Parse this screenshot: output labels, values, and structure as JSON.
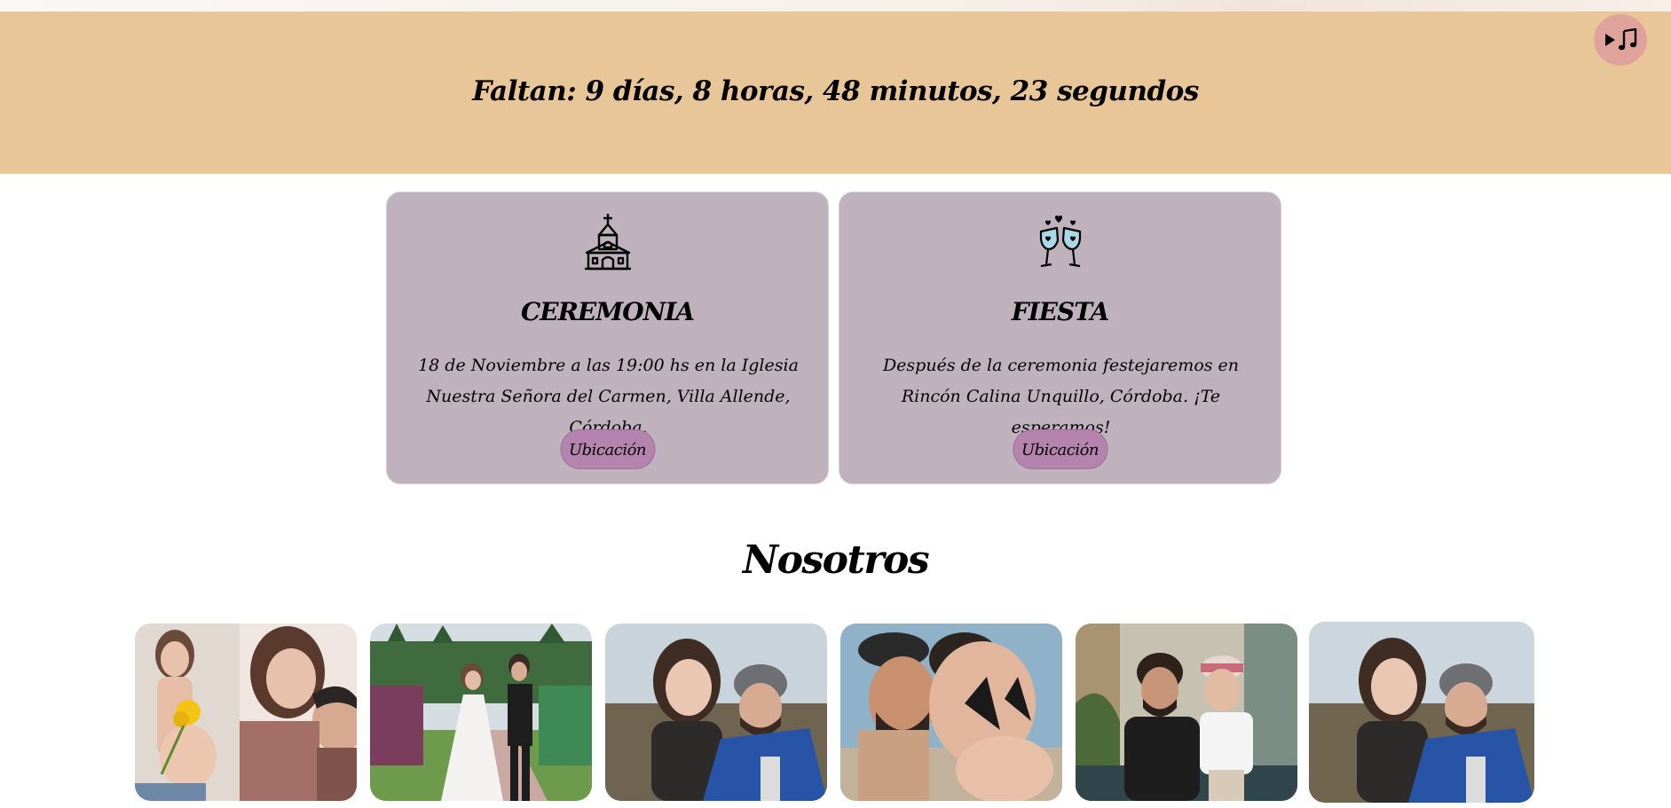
{
  "countdown": {
    "text": "Faltan: 9 días, 8 horas, 48 minutos, 23 segundos"
  },
  "music_button": {
    "icon": "play-music-icon"
  },
  "events": [
    {
      "icon": "church-icon",
      "title": "CEREMONIA",
      "text": "18 de Noviembre a las 19:00 hs en la Iglesia Nuestra Señora del Carmen, Villa Allende, Córdoba.",
      "button": "Ubicación"
    },
    {
      "icon": "toast-glasses-icon",
      "title": "FIESTA",
      "text": "Después de la ceremonia festejaremos en Rincón Calina Unquillo, Córdoba. ¡Te esperamos!",
      "button": "Ubicación"
    }
  ],
  "gallery": {
    "title": "Nosotros",
    "photos": [
      "couple-pregnancy-photo",
      "wedding-walk-photo",
      "couple-outdoor-photo",
      "couple-beach-photo",
      "couple-indoor-photo",
      "couple-outdoor-photo-2"
    ]
  },
  "colors": {
    "band": "#e8c698",
    "card": "#bfb2bd",
    "button": "#b584ae",
    "music": "#e0a39c"
  }
}
